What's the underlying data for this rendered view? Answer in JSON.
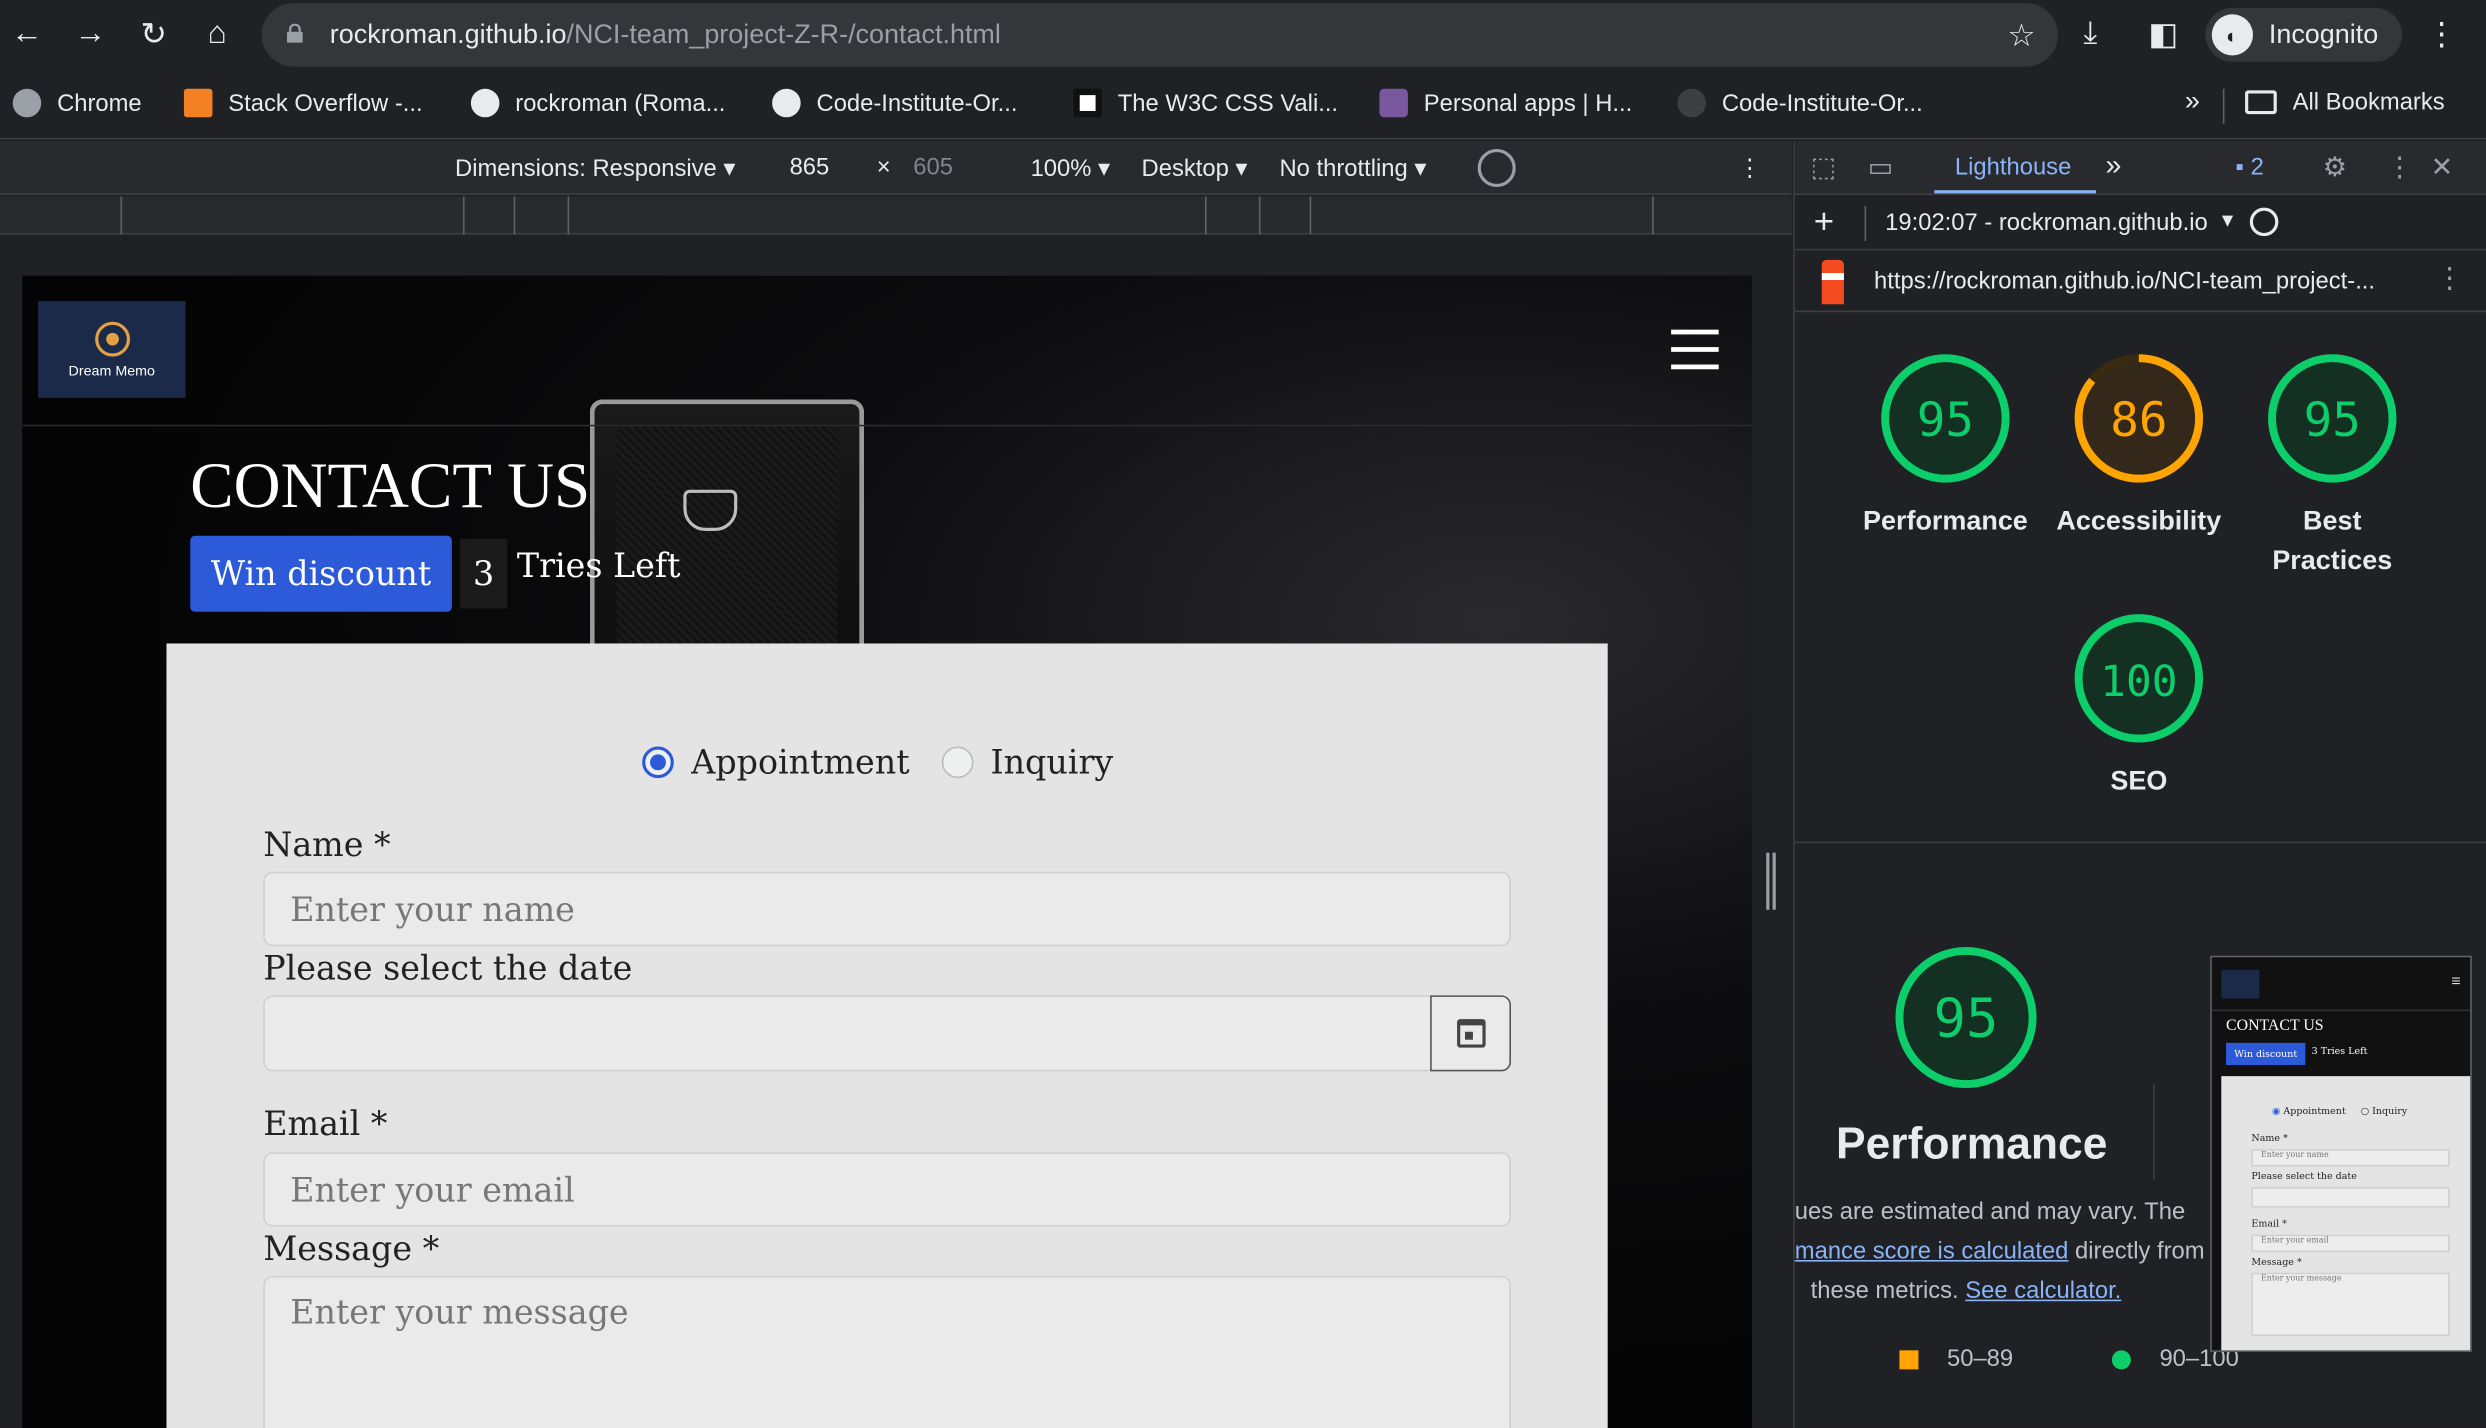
{
  "browser": {
    "url_host": "rockroman.github.io",
    "url_path": "/NCI-team_project-Z-R-/contact.html",
    "profile_label": "Incognito"
  },
  "bookmarks": {
    "items": [
      {
        "label": "Chrome",
        "icon": "chrome-icon"
      },
      {
        "label": "Stack Overflow -...",
        "icon": "stackoverflow-icon"
      },
      {
        "label": "rockroman (Roma...",
        "icon": "github-icon"
      },
      {
        "label": "Code-Institute-Or...",
        "icon": "github-icon"
      },
      {
        "label": "The W3C CSS Vali...",
        "icon": "w3c-icon"
      },
      {
        "label": "Personal apps | H...",
        "icon": "heroku-icon"
      },
      {
        "label": "Code-Institute-Or...",
        "icon": "github-icon"
      }
    ],
    "more": "»",
    "all_bookmarks": "All Bookmarks"
  },
  "device_toolbar": {
    "dimensions": "Dimensions: Responsive",
    "width": "865",
    "times": "×",
    "height": "605",
    "zoom": "100%",
    "device_type": "Desktop",
    "throttling": "No throttling"
  },
  "site": {
    "logo_text": "Dream Memo",
    "title": "CONTACT US",
    "win_button": "Win discount",
    "tries_count": "3",
    "tries_label": "Tries Left",
    "radio_appointment": "Appointment",
    "radio_inquiry": "Inquiry",
    "name_label": "Name *",
    "name_placeholder": "Enter your name",
    "date_label": "Please select the date",
    "email_label": "Email *",
    "email_placeholder": "Enter your email",
    "message_label": "Message *",
    "message_placeholder": "Enter your message"
  },
  "devtools": {
    "tab_active": "Lighthouse",
    "more_tabs": "»",
    "message_count": "2",
    "report_time": "19:02:07 - rockroman.github.io",
    "report_url": "https://rockroman.github.io/NCI-team_project-...",
    "scores": [
      {
        "name": "Performance",
        "value": "95",
        "color": "#0cce6b"
      },
      {
        "name": "Accessibility",
        "value": "86",
        "color": "#ffa400"
      },
      {
        "name": "Best Practices",
        "value": "95",
        "color": "#0cce6b"
      },
      {
        "name": "SEO",
        "value": "100",
        "color": "#0cce6b"
      }
    ],
    "perf_score": "95",
    "perf_title": "Performance",
    "perf_note_1": "ues are estimated and may vary. The",
    "perf_note_2a": "mance score is calculated",
    "perf_note_2b": " directly from",
    "perf_note_3a": "these metrics. ",
    "perf_note_3b": "See calculator.",
    "legend_mid": "50–89",
    "legend_high": "90–100",
    "thumb": {
      "title": "CONTACT US",
      "win": "Win discount",
      "tries": "3   Tries Left",
      "appointment": "Appointment",
      "inquiry": "Inquiry",
      "name": "Name *",
      "name_ph": "Enter your name",
      "date": "Please select the date",
      "email": "Email *",
      "email_ph": "Enter your email",
      "message": "Message *",
      "message_ph": "Enter your message"
    }
  }
}
